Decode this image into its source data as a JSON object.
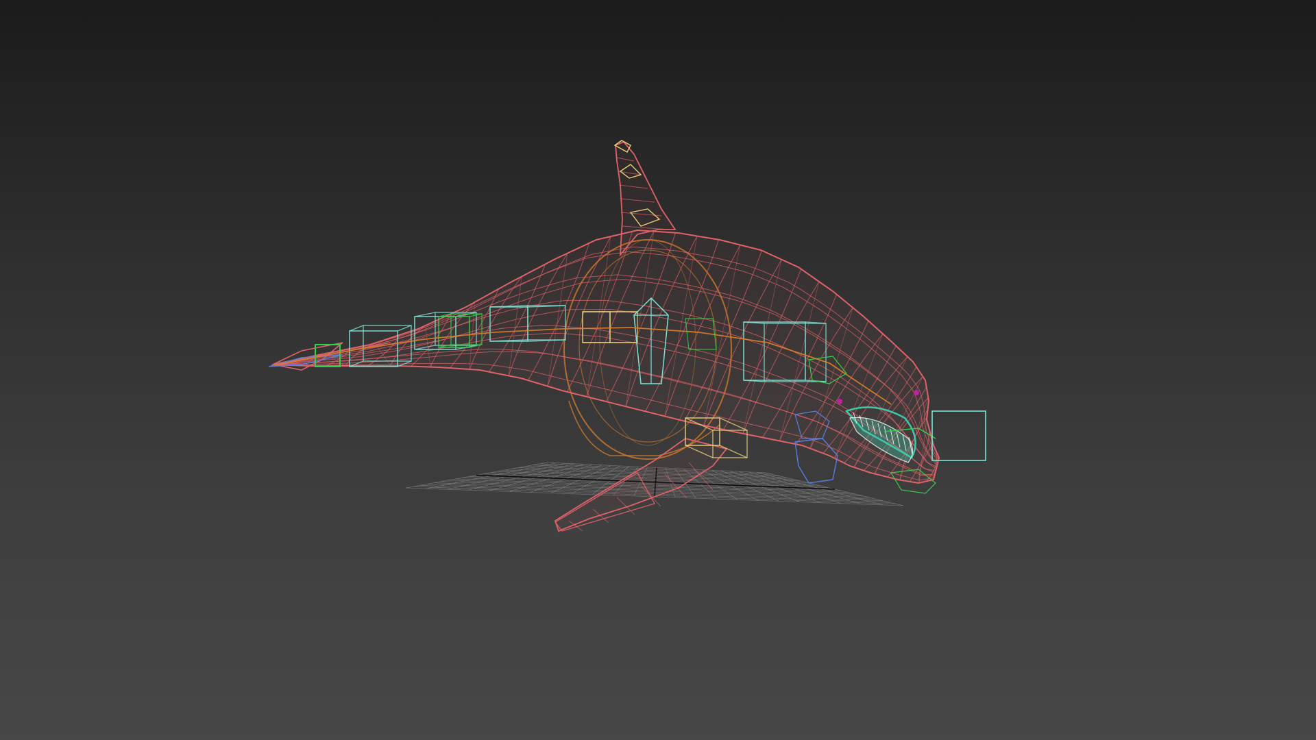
{
  "viewport": {
    "background_top": "#1b1b1b",
    "background_bottom": "#474747",
    "render_mode": "wireframe"
  },
  "scene": {
    "subject": "orca",
    "colors": {
      "mesh": "#e0626a",
      "rig_orange": "#d9802e",
      "bone_yellow": "#e8d07a",
      "helper_cyan": "#7fe3d6",
      "helper_green": "#35d04a",
      "helper_blue": "#5a7ee0",
      "teeth_teal": "#3fc9a8",
      "grid": "#7a7a7a",
      "grid_axis": "#111111",
      "eye_magenta": "#c020a0"
    }
  }
}
